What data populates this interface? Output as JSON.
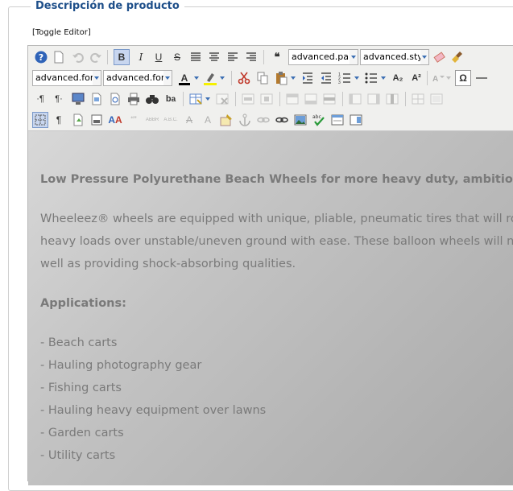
{
  "legend": "Descripción de producto",
  "toggle": "[Toggle Editor]",
  "toolbar": {
    "row1": [
      "help-icon",
      "new-document-icon",
      "undo-icon",
      "redo-icon",
      "B",
      "I",
      "U",
      "S",
      "justify-full-icon",
      "align-center-icon",
      "align-left-icon",
      "align-right-icon",
      "blockquote-icon"
    ],
    "paragraph_dropdown": "advanced.paragraph",
    "style_dropdown": "advanced.style",
    "font_family_dropdown": "advanced.fontdefault",
    "font_size_dropdown": "advanced.font_size",
    "forecolor": "A",
    "subscript": "A₂",
    "superscript": "A²",
    "special_char": "Ω",
    "abbr_labels": [
      "ABBR",
      "A.B.C."
    ]
  },
  "content": {
    "heading": "Low Pressure Polyurethane Beach Wheels for more heavy duty, ambitious u",
    "para_lines": [
      "Wheeleez® wheels are equipped with unique, pliable, pneumatic tires that will roll, e",
      "heavy loads over unstable/uneven ground with ease. These balloon wheels will not s",
      "well as providing shock-absorbing qualities."
    ],
    "applications_label": "Applications:",
    "items": [
      "- Beach carts",
      "- Hauling photography gear",
      "- Fishing carts",
      "- Hauling heavy equipment over lawns",
      "- Garden carts",
      "- Utility carts"
    ]
  },
  "colors": {
    "legend": "#1e4f8a",
    "text": "#7a7a7a",
    "toolbar": "#f0f0ee"
  }
}
